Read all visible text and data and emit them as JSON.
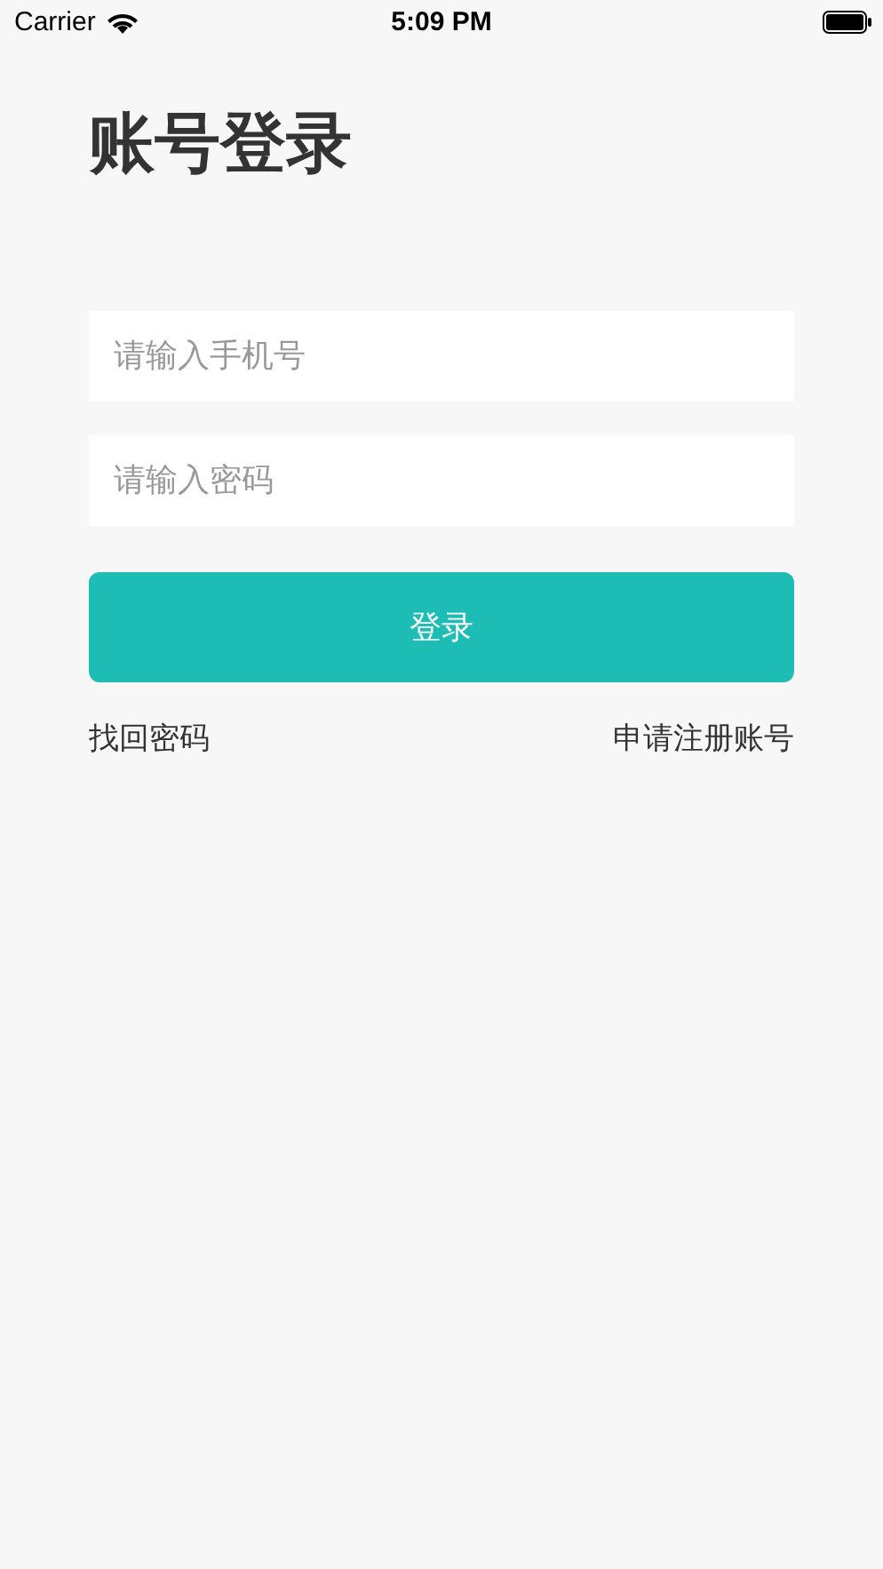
{
  "status_bar": {
    "carrier": "Carrier",
    "time": "5:09 PM"
  },
  "title": "账号登录",
  "fields": [
    {
      "placeholder": "请输入手机号"
    },
    {
      "placeholder": "请输入密码"
    }
  ],
  "login_button": "登录",
  "links": [
    "找回密码",
    "申请注册账号"
  ]
}
